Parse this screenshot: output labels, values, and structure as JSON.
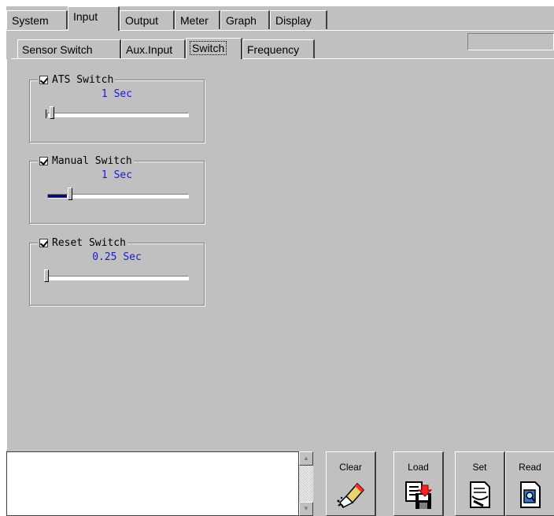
{
  "tabs_main": [
    "System",
    "Input",
    "Output",
    "Meter",
    "Graph",
    "Display"
  ],
  "tabs_sub": [
    "Sensor Switch",
    "Aux.Input",
    "Switch",
    "Frequency"
  ],
  "groups": [
    {
      "label": "ATS Switch",
      "checked": true,
      "value": "1 Sec",
      "slider_fraction": 0.0
    },
    {
      "label": "Manual Switch",
      "checked": true,
      "value": "1 Sec",
      "slider_fraction": 0.13
    },
    {
      "label": "Reset Switch",
      "checked": true,
      "value": "0.25 Sec",
      "slider_fraction": 0.0
    }
  ],
  "buttons": {
    "clear": "Clear",
    "load": "Load",
    "set": "Set",
    "read": "Read"
  },
  "icons": {
    "clear": "eraser-icon",
    "load": "load-disk-icon",
    "set": "set-document-icon",
    "read": "read-document-icon"
  },
  "colors": {
    "window": "#c0c0c0",
    "value_text": "#1a1ad6",
    "slider_fill": "#0a0a80"
  }
}
